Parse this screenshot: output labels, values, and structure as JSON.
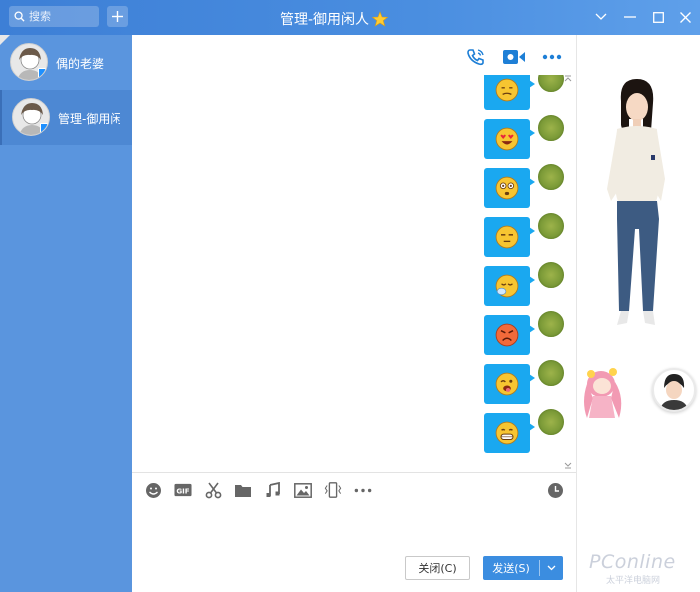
{
  "search": {
    "placeholder": "搜索"
  },
  "window": {
    "title": "管理-御用闲人"
  },
  "contacts": [
    {
      "name": "偶的老婆"
    },
    {
      "name": "管理-御用闲人"
    }
  ],
  "emojis": [
    {
      "name": "awkward",
      "color": "#f7c531"
    },
    {
      "name": "heart-eyes",
      "color": "#f7c531"
    },
    {
      "name": "dizzy",
      "color": "#f7c531"
    },
    {
      "name": "unamused",
      "color": "#f7c531"
    },
    {
      "name": "sleepy",
      "color": "#f7c531"
    },
    {
      "name": "angry",
      "color": "#f26a3a"
    },
    {
      "name": "tongue-wink",
      "color": "#f7c531"
    },
    {
      "name": "grin",
      "color": "#f7c531"
    }
  ],
  "buttons": {
    "close": "关闭(C)",
    "send": "发送(S)"
  },
  "toolbar_tools": [
    "emoji-icon",
    "gif-icon",
    "scissors-icon",
    "folder-icon",
    "music-icon",
    "image-icon",
    "shake-icon",
    "more-icon"
  ],
  "watermark": {
    "brand": "PConline",
    "sub": "太平洋电脑网"
  },
  "colors": {
    "accent": "#3b8de0",
    "sidebar": "#5a95de",
    "bubble": "#1aa8f0"
  }
}
